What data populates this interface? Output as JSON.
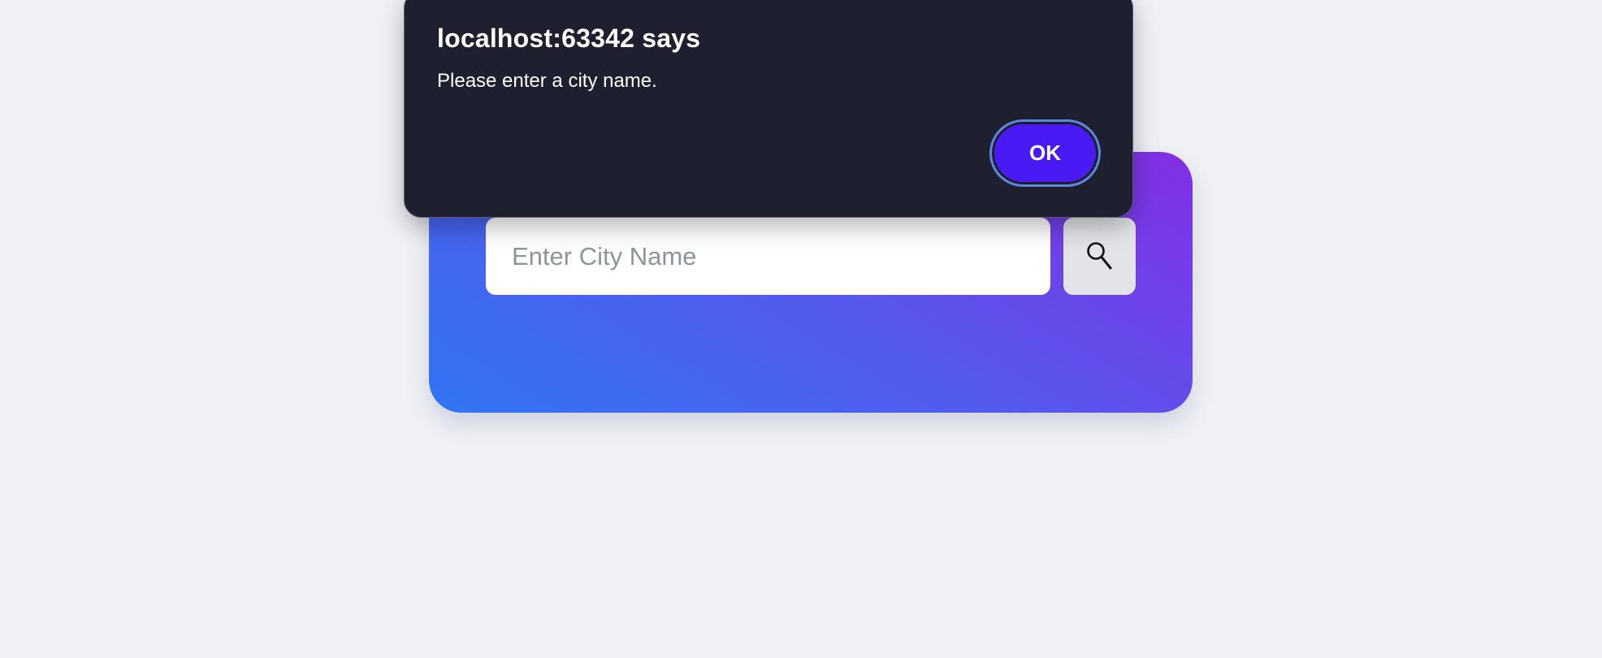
{
  "search": {
    "placeholder": "Enter City Name",
    "value": "",
    "button_icon": "search-icon"
  },
  "card": {
    "gradient_colors": [
      "#3175f4",
      "#5658ee",
      "#842ee4"
    ]
  },
  "alert": {
    "title": "localhost:63342 says",
    "message": "Please enter a city name.",
    "ok_label": "OK",
    "ok_color": "#4a1af5",
    "background_color": "#1e2030"
  },
  "page": {
    "background_color": "#eff1f5"
  }
}
